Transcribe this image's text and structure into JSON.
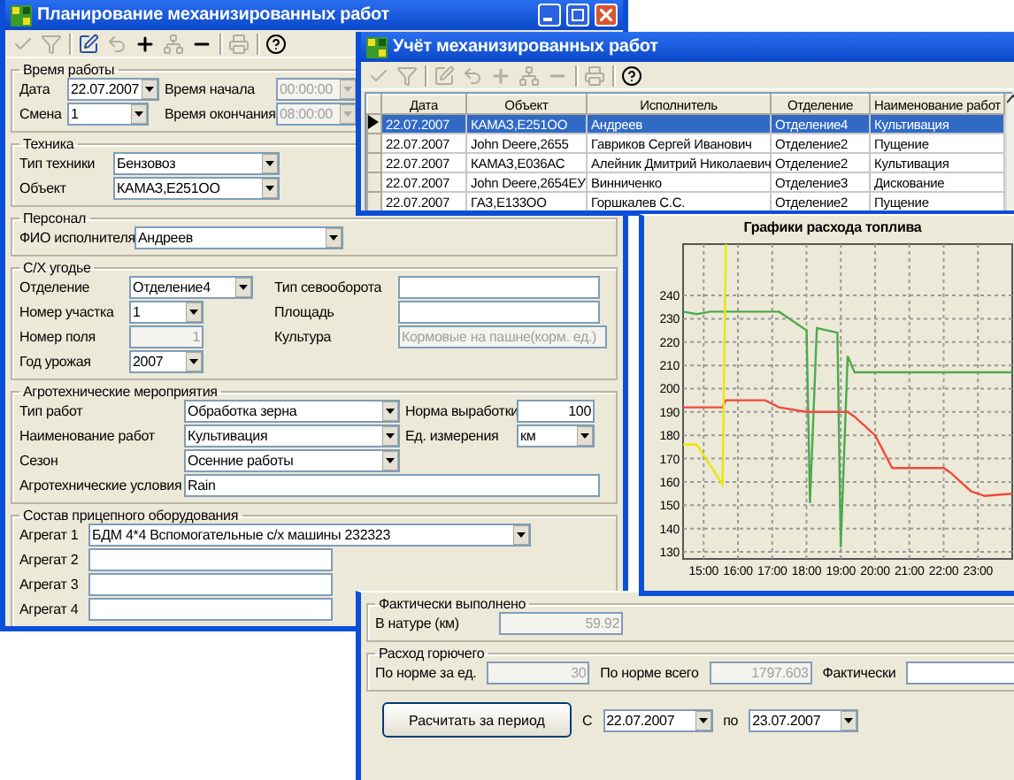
{
  "planning_window": {
    "title": "Планирование механизированных работ",
    "toolbar": [
      {
        "kind": "check",
        "disabled": true
      },
      {
        "kind": "filter",
        "disabled": true
      },
      {
        "kind": "edit",
        "disabled": false
      },
      {
        "kind": "undo",
        "disabled": true
      },
      {
        "kind": "plus",
        "disabled": false
      },
      {
        "kind": "nodes",
        "disabled": true
      },
      {
        "kind": "minus",
        "disabled": false
      },
      {
        "kind": "print",
        "disabled": true
      },
      {
        "kind": "help",
        "disabled": false
      }
    ],
    "work_time": {
      "legend": "Время работы",
      "fields": [
        {
          "label": "Дата",
          "value": "22.07.2007",
          "kind": "combo",
          "disabled": false
        },
        {
          "label": "Время начала",
          "value": "00:00:00",
          "kind": "combo",
          "disabled": true
        },
        {
          "label": "Смена",
          "value": "1",
          "kind": "combo",
          "disabled": false
        },
        {
          "label": "Время окончания",
          "value": "08:00:00",
          "kind": "combo",
          "disabled": true
        }
      ]
    },
    "machinery": {
      "legend": "Техника",
      "fields": [
        {
          "label": "Тип техники",
          "value": "Бензовоз",
          "kind": "combo",
          "disabled": false
        },
        {
          "label": "Объект",
          "value": "КАМАЗ,Е251ОО",
          "kind": "combo",
          "disabled": false
        }
      ]
    },
    "personnel": {
      "legend": "Персонал",
      "fields": [
        {
          "label": "ФИО исполнителя",
          "value": "Андреев",
          "kind": "combo",
          "disabled": false
        }
      ]
    },
    "land": {
      "legend": "С/Х угодье",
      "fields": [
        {
          "label": "Отделение",
          "value": "Отделение4",
          "kind": "combo",
          "disabled": false
        },
        {
          "label": "Тип севооборота",
          "kind": "text",
          "disabled": false
        },
        {
          "label": "Номер участка",
          "value": "1",
          "kind": "combo",
          "disabled": false
        },
        {
          "label": "Площадь",
          "kind": "text",
          "disabled": false
        },
        {
          "label": "Номер поля",
          "value": "1",
          "kind": "number",
          "disabled": true
        },
        {
          "label": "Культура",
          "value": "Кормовые на пашне(корм. ед.)",
          "kind": "text",
          "disabled": true
        },
        {
          "label": "Год урожая",
          "value": "2007",
          "kind": "combo",
          "disabled": false
        }
      ]
    },
    "agro": {
      "legend": "Агротехнические мероприятия",
      "fields": [
        {
          "label": "Тип работ",
          "value": "Обработка зерна",
          "kind": "combo",
          "disabled": false
        },
        {
          "label": "Норма выработки",
          "value": "100",
          "kind": "number",
          "disabled": false
        },
        {
          "label": "Наименование работ",
          "value": "Культивация",
          "kind": "combo",
          "disabled": false
        },
        {
          "label": "Ед. измерения",
          "value": "км",
          "kind": "combo",
          "disabled": false
        },
        {
          "label": "Сезон",
          "value": "Осенние работы",
          "kind": "combo",
          "disabled": false
        },
        {
          "label": "Агротехнические условия",
          "value": "Rain",
          "kind": "text",
          "disabled": false
        }
      ]
    },
    "equipment": {
      "legend": "Состав прицепного оборудования",
      "fields": [
        {
          "label": "Агрегат 1",
          "value": "БДМ 4*4  Вспомогательные с/х машины  232323",
          "kind": "combo",
          "disabled": false
        },
        {
          "label": "Агрегат 2",
          "kind": "text",
          "disabled": false
        },
        {
          "label": "Агрегат 3",
          "kind": "text",
          "disabled": false
        },
        {
          "label": "Агрегат 4",
          "kind": "text",
          "disabled": false
        }
      ]
    }
  },
  "records_window": {
    "title": "Учёт механизированных работ",
    "toolbar": [
      {
        "kind": "check",
        "disabled": true
      },
      {
        "kind": "filter",
        "disabled": true
      },
      {
        "kind": "edit",
        "disabled": true
      },
      {
        "kind": "undo",
        "disabled": true
      },
      {
        "kind": "plus",
        "disabled": true
      },
      {
        "kind": "nodes",
        "disabled": true
      },
      {
        "kind": "minus",
        "disabled": true
      },
      {
        "kind": "print",
        "disabled": true
      },
      {
        "kind": "help",
        "disabled": false
      }
    ],
    "table": {
      "columns": [
        "Дата",
        "Объект",
        "Исполнитель",
        "Отделение",
        "Наименование работ"
      ],
      "rows": [
        {
          "cells": [
            "22.07.2007",
            "КАМАЗ,Е251ОО",
            "Андреев",
            "Отделение4",
            "Культивация"
          ],
          "selected": true
        },
        {
          "cells": [
            "22.07.2007",
            "John Deere,2655",
            "Гавриков Сергей Иванович",
            "Отделение2",
            "Пущение"
          ],
          "selected": false
        },
        {
          "cells": [
            "22.07.2007",
            "КАМАЗ,Е036АС",
            "Алейник Дмитрий Николаевич",
            "Отделение2",
            "Культивация"
          ],
          "selected": false
        },
        {
          "cells": [
            "22.07.2007",
            "John Deere,2654ЕУ",
            "Винниченко",
            "Отделение3",
            "Дискование"
          ],
          "selected": false
        },
        {
          "cells": [
            "22.07.2007",
            "ГАЗ,Е133ОО",
            "Горшкалев С.С.",
            "Отделение2",
            "Пущение"
          ],
          "selected": false
        }
      ]
    },
    "chart_data": {
      "type": "line",
      "title": "Графики расхода топлива",
      "grid": true,
      "x": [
        14.4,
        14.8,
        15.2,
        15.55,
        15.65,
        16.8,
        17.2,
        18.0,
        18.1,
        18.3,
        18.9,
        19.0,
        19.2,
        19.4,
        20.0,
        20.5,
        21.0,
        22.0,
        22.2,
        22.8,
        23.2,
        24.0
      ],
      "series": [
        {
          "color": "#4caa4c",
          "values": [
            233,
            232,
            233,
            233,
            233,
            233,
            233,
            225,
            151,
            226,
            224,
            132,
            214,
            207,
            207,
            207,
            207,
            207,
            207,
            207,
            207,
            207
          ]
        },
        {
          "color": "#f04a3a",
          "values": [
            192,
            192,
            192,
            192,
            195,
            195,
            192,
            190,
            190,
            190,
            190,
            190,
            190,
            188,
            180,
            166,
            166,
            166,
            164,
            156,
            154,
            155
          ]
        },
        {
          "color": "#e8e800",
          "values": [
            176,
            176,
            167,
            159,
            262,
            null,
            null,
            null,
            null,
            null,
            null,
            null,
            null,
            null,
            null,
            null,
            null,
            null,
            null,
            null,
            null,
            null
          ]
        }
      ],
      "xlim": [
        14.4,
        24
      ],
      "ylim": [
        127,
        262
      ],
      "xticks": [
        {
          "value": 15,
          "label": "15:00"
        },
        {
          "value": 16,
          "label": "16:00"
        },
        {
          "value": 17,
          "label": "17:00"
        },
        {
          "value": 18,
          "label": "18:00"
        },
        {
          "value": 19,
          "label": "19:00"
        },
        {
          "value": 20,
          "label": "20:00"
        },
        {
          "value": 21,
          "label": "21:00"
        },
        {
          "value": 22,
          "label": "22:00"
        },
        {
          "value": 23,
          "label": "23:00"
        }
      ],
      "yticks": [
        130,
        140,
        150,
        160,
        170,
        180,
        190,
        200,
        210,
        220,
        230,
        240
      ]
    },
    "done": {
      "legend": "Фактически выполнено",
      "fields": [
        {
          "label": "В натуре (км)",
          "value": "59.92",
          "kind": "number",
          "disabled": true
        }
      ]
    },
    "fuel": {
      "legend": "Расход горючего",
      "fields": [
        {
          "label": "По норме за ед.",
          "value": "30",
          "kind": "number",
          "disabled": true
        },
        {
          "label": "По норме всего",
          "value": "1797.603",
          "kind": "number",
          "disabled": true
        },
        {
          "label": "Фактически",
          "kind": "text",
          "disabled": false
        }
      ]
    },
    "calc_button": "Расчитать за период",
    "period": [
      {
        "label": "С",
        "value": "22.07.2007",
        "kind": "combo",
        "disabled": false
      },
      {
        "label": "по",
        "value": "23.07.2007",
        "kind": "combo",
        "disabled": false
      }
    ]
  }
}
